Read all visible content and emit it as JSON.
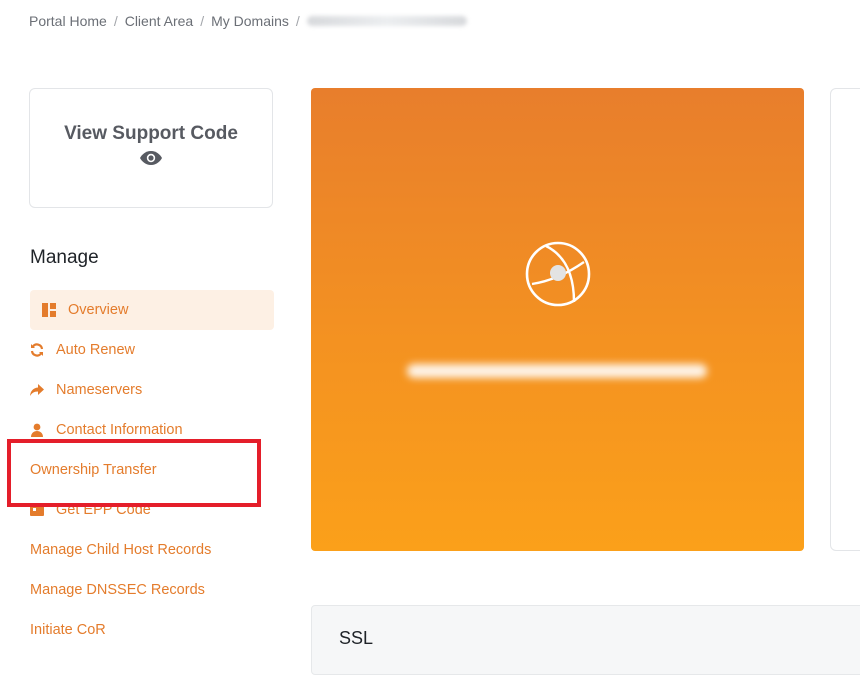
{
  "breadcrumb": {
    "items": [
      "Portal Home",
      "Client Area",
      "My Domains"
    ],
    "separator": "/"
  },
  "support_card": {
    "title": "View Support Code",
    "icon": "eye-icon"
  },
  "manage": {
    "heading": "Manage",
    "items": [
      {
        "label": "Overview",
        "icon": "dashboard-icon",
        "active": true
      },
      {
        "label": "Auto Renew",
        "icon": "refresh-icon"
      },
      {
        "label": "Nameservers",
        "icon": "share-arrow-icon"
      },
      {
        "label": "Contact Information",
        "icon": "user-icon"
      },
      {
        "label": "Ownership Transfer",
        "icon": ""
      },
      {
        "label": "Get EPP Code",
        "icon": "code-icon"
      },
      {
        "label": "Manage Child Host Records",
        "icon": ""
      },
      {
        "label": "Manage DNSSEC Records",
        "icon": ""
      },
      {
        "label": "Initiate CoR",
        "icon": ""
      }
    ]
  },
  "hero": {
    "icon": "globe-icon"
  },
  "ssl": {
    "title": "SSL"
  },
  "colors": {
    "accent": "#e47c2c",
    "hero_top": "#e87e2c",
    "hero_bottom": "#fba01a",
    "highlight": "#e41e2a"
  }
}
